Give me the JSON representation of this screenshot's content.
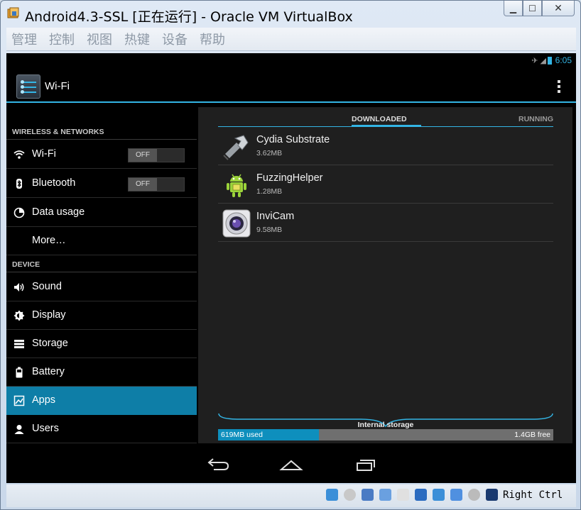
{
  "window": {
    "title": "Android4.3-SSL [正在运行] - Oracle VM VirtualBox",
    "icon": "virtualbox-icon",
    "controls": [
      "minimize-icon",
      "maximize-icon",
      "close-icon"
    ]
  },
  "menubar": {
    "items": [
      "管理",
      "控制",
      "视图",
      "热键",
      "设备",
      "帮助"
    ]
  },
  "android": {
    "status": {
      "time": "6:05"
    },
    "actionbar": {
      "title": "Wi-Fi",
      "icon": "settings-icon"
    },
    "settings": {
      "section_wireless": "WIRELESS & NETWORKS",
      "section_device": "DEVICE",
      "wireless_items": [
        {
          "label": "Wi-Fi",
          "icon": "wifi-icon",
          "toggle": "OFF"
        },
        {
          "label": "Bluetooth",
          "icon": "bluetooth-icon",
          "toggle": "OFF"
        },
        {
          "label": "Data usage",
          "icon": "data-usage-icon"
        },
        {
          "label": "More…"
        }
      ],
      "device_items": [
        {
          "label": "Sound",
          "icon": "speaker-icon"
        },
        {
          "label": "Display",
          "icon": "brightness-icon"
        },
        {
          "label": "Storage",
          "icon": "storage-icon"
        },
        {
          "label": "Battery",
          "icon": "battery-icon"
        },
        {
          "label": "Apps",
          "icon": "apps-icon",
          "selected": true
        },
        {
          "label": "Users",
          "icon": "user-icon"
        }
      ]
    },
    "apps": {
      "tabs": {
        "downloaded": "DOWNLOADED",
        "running": "RUNNING"
      },
      "list": [
        {
          "name": "Cydia Substrate",
          "size": "3.62MB",
          "icon": "cydia-substrate-icon"
        },
        {
          "name": "FuzzingHelper",
          "size": "1.28MB",
          "icon": "android-robot-icon"
        },
        {
          "name": "InviCam",
          "size": "9.58MB",
          "icon": "camera-lens-icon"
        }
      ],
      "storage": {
        "label": "Internal storage",
        "used": "619MB used",
        "free": "1.4GB free",
        "used_fraction": 0.3
      }
    },
    "navbar": [
      "back-icon",
      "home-icon",
      "recent-apps-icon"
    ]
  },
  "hoststatus": {
    "host_key": "Right Ctrl",
    "colors": {
      "accent": "#33b5e5",
      "selected": "#0e7ea7"
    }
  }
}
